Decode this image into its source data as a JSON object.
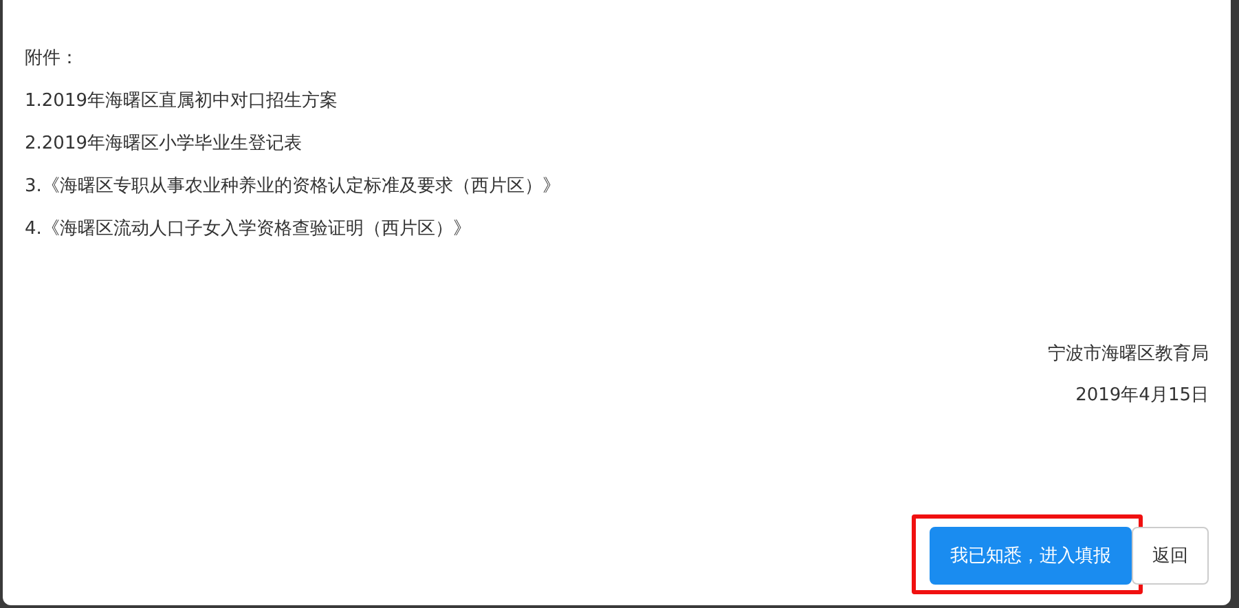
{
  "attachments": {
    "heading": "附件：",
    "items": [
      "1.2019年海曙区直属初中对口招生方案",
      "2.2019年海曙区小学毕业生登记表",
      "3.《海曙区专职从事农业种养业的资格认定标准及要求（西片区）》",
      "4.《海曙区流动人口子女入学资格查验证明（西片区）》"
    ]
  },
  "signature": {
    "issuer": "宁波市海曙区教育局",
    "date": "2019年4月15日"
  },
  "buttons": [
    {
      "label": "我已知悉，进入填报",
      "kind": "primary",
      "highlighted": true
    },
    {
      "label": "返回",
      "kind": "secondary",
      "highlighted": false
    }
  ]
}
